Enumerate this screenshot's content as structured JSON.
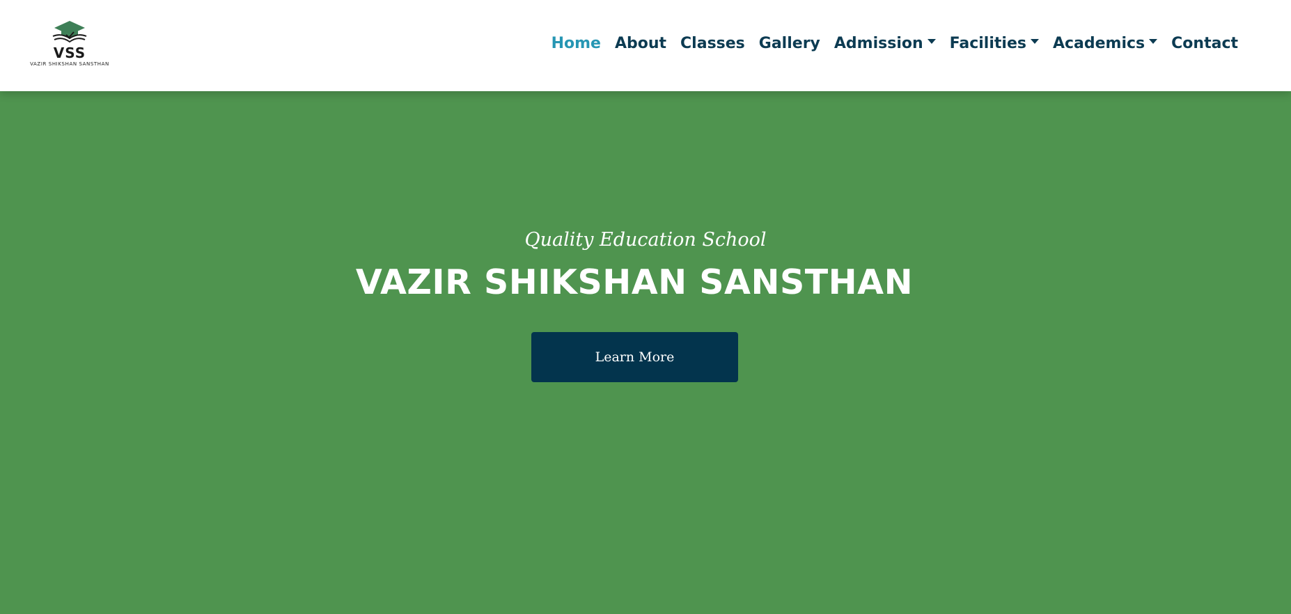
{
  "header": {
    "logo": {
      "abbr": "VSS",
      "full_name": "VAZIR SHIKSHAN SANSTHAN",
      "icon": "graduation-cap-book-icon",
      "color": "#3e7f57"
    },
    "nav": [
      {
        "label": "Home",
        "active": true,
        "dropdown": false
      },
      {
        "label": "About",
        "active": false,
        "dropdown": false
      },
      {
        "label": "Classes",
        "active": false,
        "dropdown": false
      },
      {
        "label": "Gallery",
        "active": false,
        "dropdown": false
      },
      {
        "label": "Admission",
        "active": false,
        "dropdown": true
      },
      {
        "label": "Facilities",
        "active": false,
        "dropdown": true
      },
      {
        "label": "Academics",
        "active": false,
        "dropdown": true
      },
      {
        "label": "Contact",
        "active": false,
        "dropdown": false
      }
    ]
  },
  "hero": {
    "subtitle": "Quality Education School",
    "title": "VAZIR SHIKSHAN SANSTHAN",
    "cta_label": "Learn More"
  },
  "colors": {
    "hero_background": "#4f944f",
    "nav_text": "#0c3b52",
    "nav_active": "#2696b3",
    "button_background": "#03344d"
  }
}
